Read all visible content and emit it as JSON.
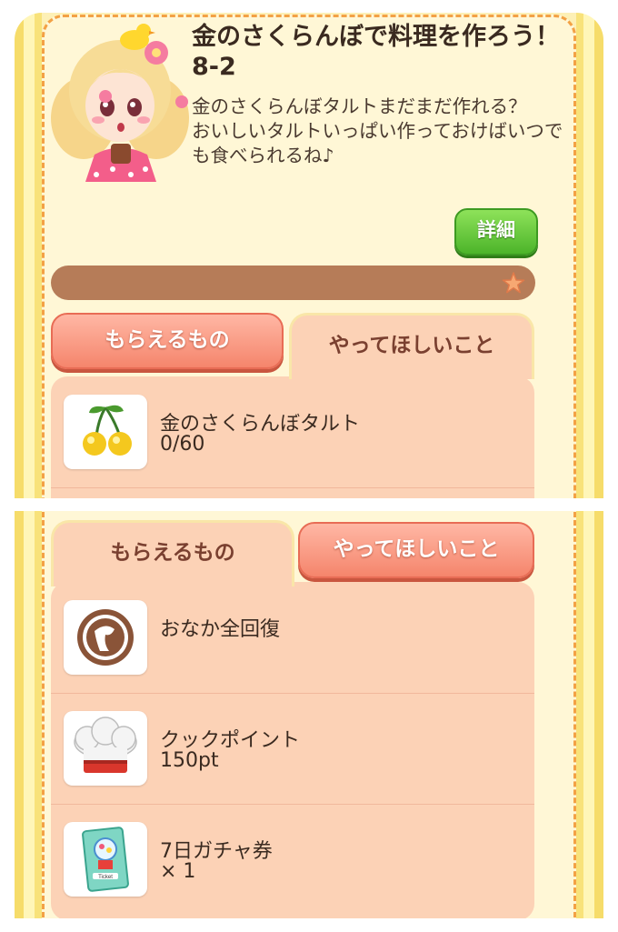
{
  "quest": {
    "title": "金のさくらんぼで料理を作ろう！8-2",
    "description": "金のさくらんぼタルトまだまだ作れる？\nおいしいタルトいっぱい作っておけばいつでも食べられるね♪",
    "detail_label": "詳細"
  },
  "tabs": {
    "rewards_label": "もらえるもの",
    "tasks_label": "やってほしいこと"
  },
  "task": {
    "icon": "golden-cherry-icon",
    "name": "金のさくらんぼタルト",
    "progress": "0/60"
  },
  "rewards": [
    {
      "icon": "stomach-recovery-icon",
      "name": "おなか全回復",
      "sub": ""
    },
    {
      "icon": "chef-hat-icon",
      "name": "クックポイント",
      "sub": "150pt"
    },
    {
      "icon": "gacha-ticket-icon",
      "name": "7日ガチャ券",
      "sub": "× 1"
    }
  ],
  "colors": {
    "panel": "#fdf0b6",
    "card": "#fff7d6",
    "tab": "#f5856c",
    "content": "#fcd2b6",
    "detail": "#4cb42a"
  }
}
